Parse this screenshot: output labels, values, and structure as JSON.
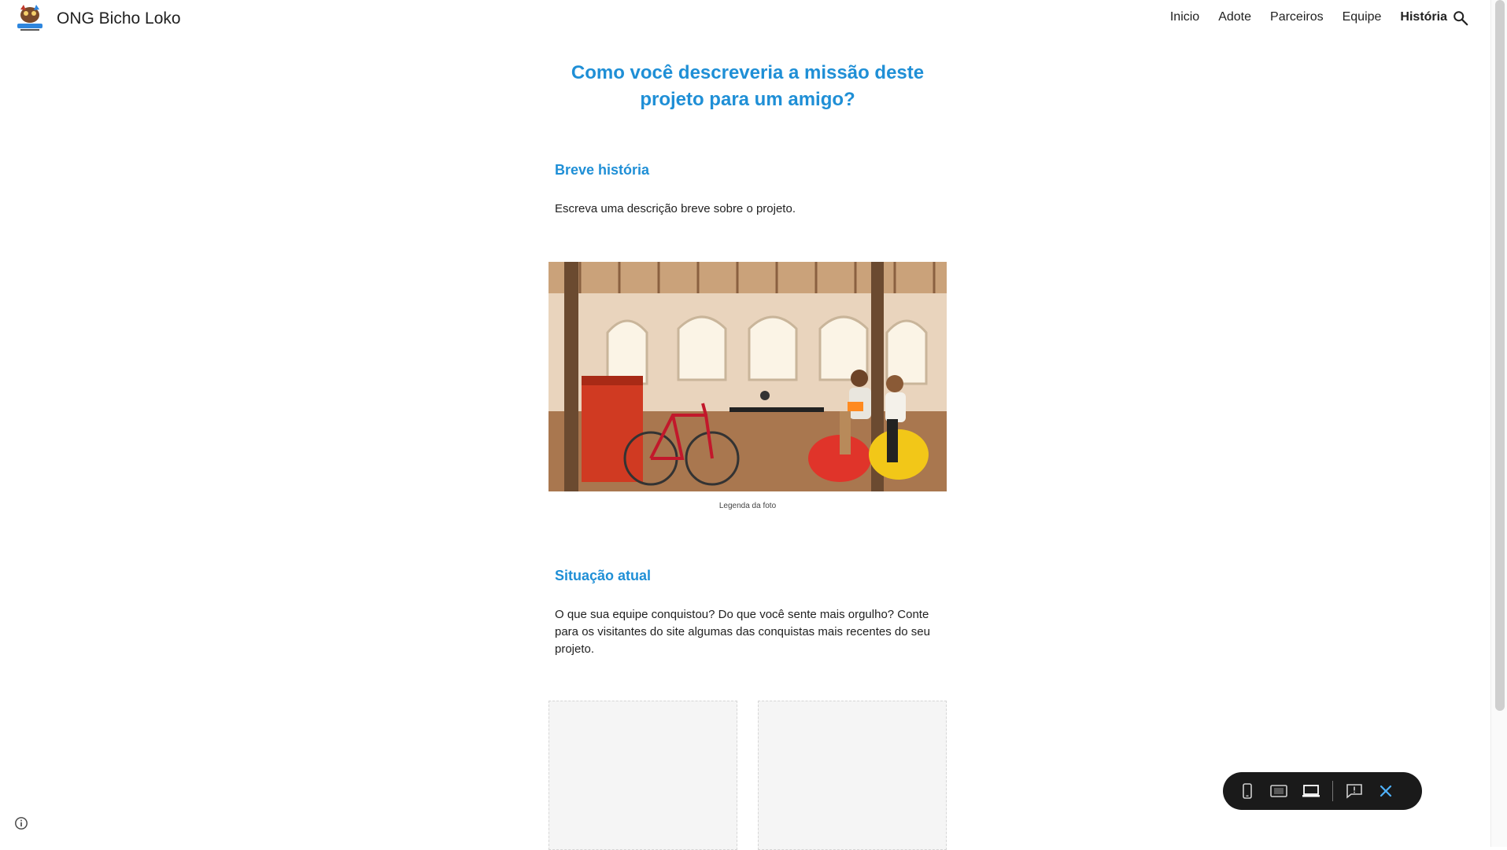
{
  "header": {
    "site_title": "ONG Bicho Loko",
    "nav": [
      "Inicio",
      "Adote",
      "Parceiros",
      "Equipe",
      "História"
    ],
    "active_nav": "História"
  },
  "main": {
    "hero_title_line1": "Como você descreveria a missão deste",
    "hero_title_line2": "projeto para um amigo?",
    "section1_title": "Breve história",
    "section1_text": "Escreva uma descrição breve sobre o projeto.",
    "photo_caption": "Legenda da foto",
    "section2_title": "Situação atual",
    "section2_text": "O que sua equipe conquistou? Do que você sente mais orgulho? Conte para os visitantes do site algumas das conquistas mais recentes do seu projeto."
  },
  "preview_toolbar": {
    "icons": [
      "phone-icon",
      "tablet-icon",
      "laptop-icon",
      "report-issue-icon",
      "close-icon"
    ],
    "accent": "#4fb3ff"
  },
  "colors": {
    "heading": "#1f8fd6",
    "text": "#212121"
  }
}
